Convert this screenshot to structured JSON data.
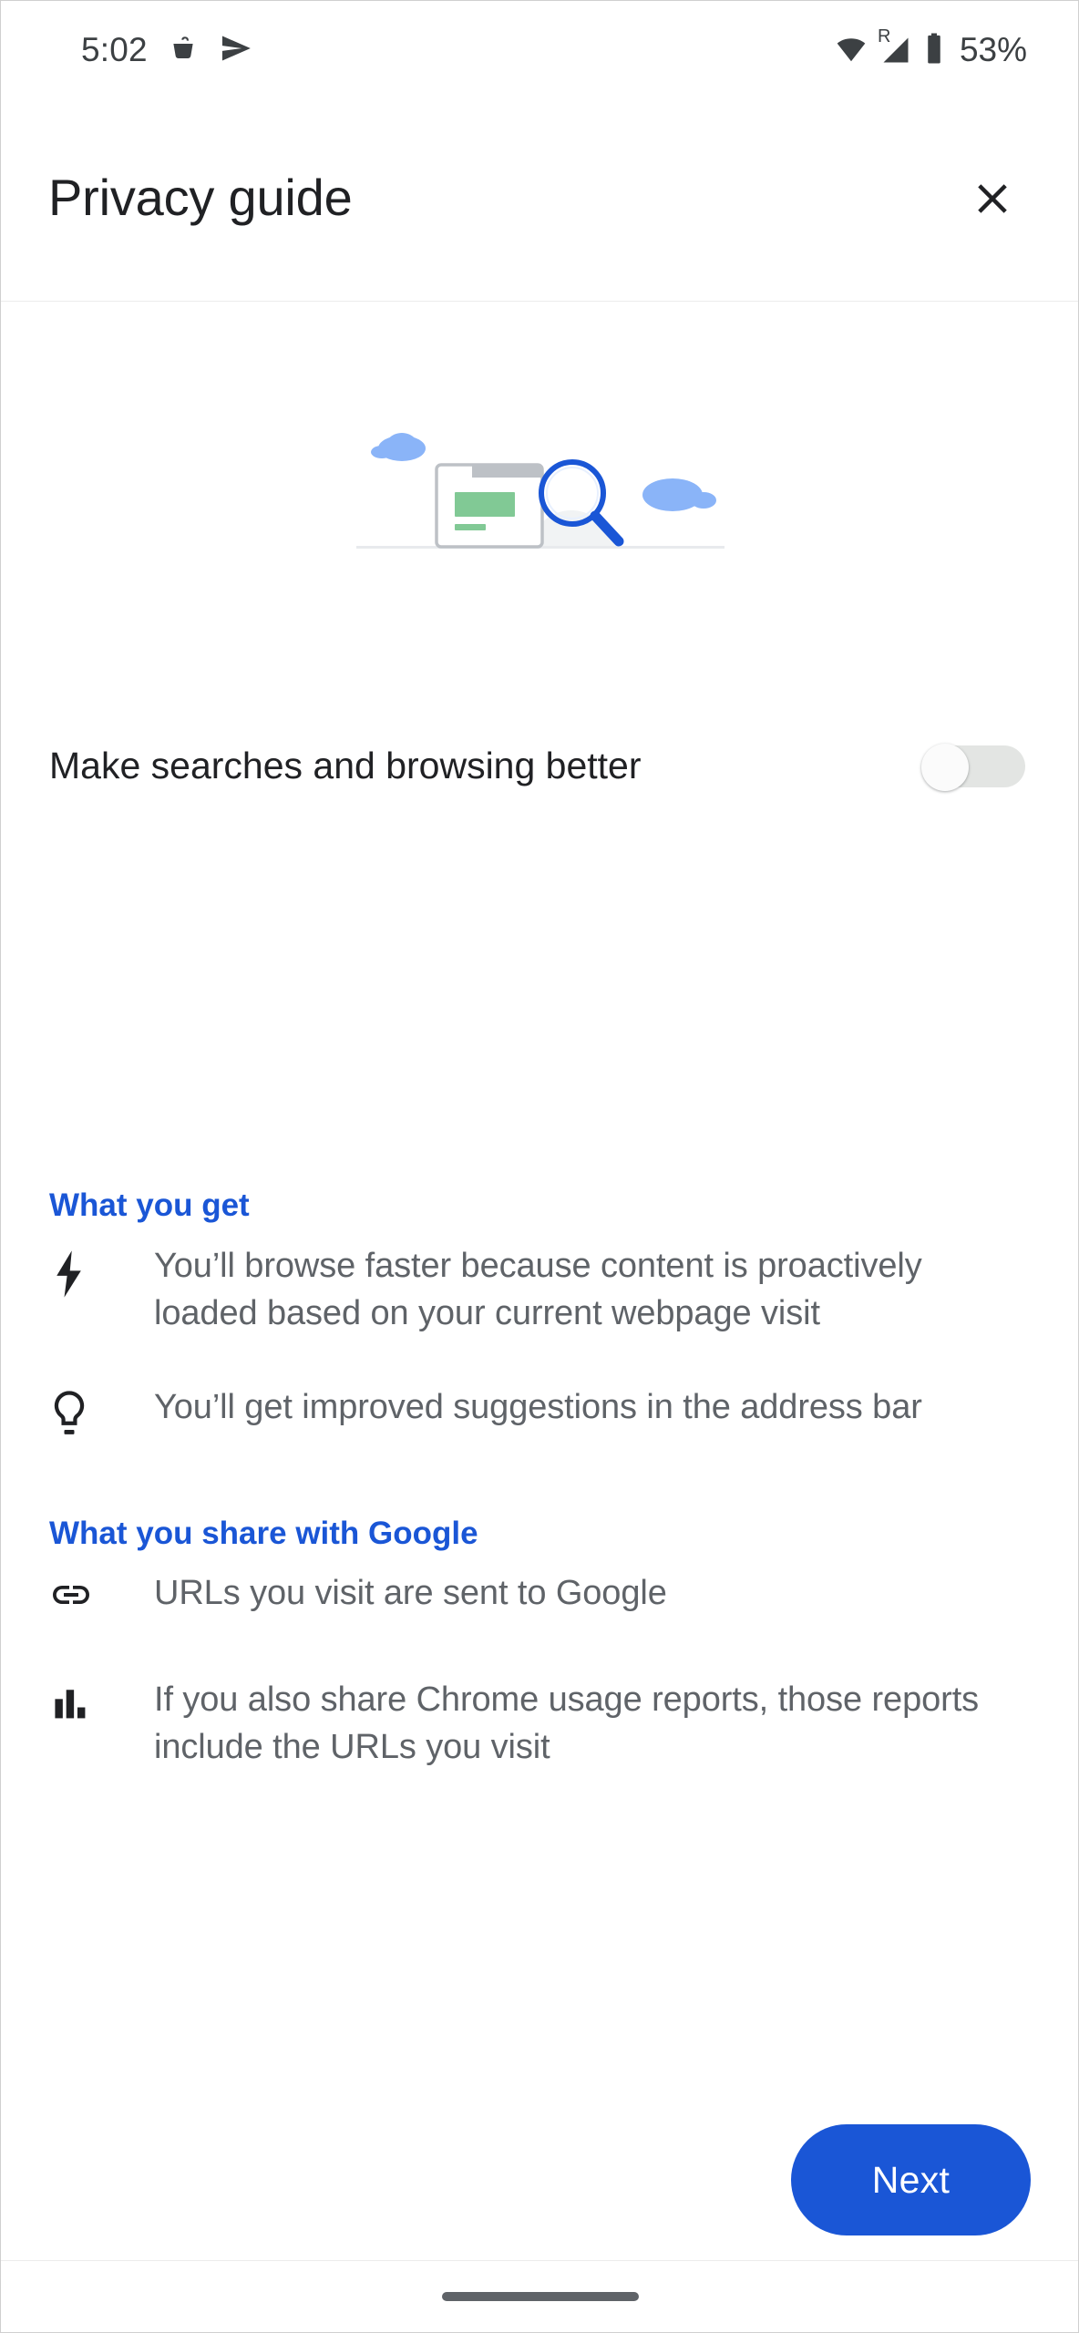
{
  "status_bar": {
    "time": "5:02",
    "battery_percent": "53%",
    "roaming_label": "R",
    "icons": [
      "drink-icon",
      "send-icon",
      "wifi-icon",
      "cellular-signal-icon",
      "battery-icon"
    ]
  },
  "app_bar": {
    "title": "Privacy guide",
    "close_icon": "close-icon"
  },
  "illustration": {
    "name": "search-and-browsing-illustration",
    "cloud_color": "#8ab4f8",
    "card_border_color": "#bdc1c6",
    "card_tab_color": "#bdc1c6",
    "highlight_color": "#81c995",
    "magnifier_color": "#1a56d6"
  },
  "toggle": {
    "label": "Make searches and browsing better",
    "state": "off",
    "track_color": "#e3e5e3",
    "thumb_color": "#fbfbfb"
  },
  "sections": [
    {
      "header": "What you get",
      "header_color": "#1a56d6",
      "items": [
        {
          "icon": "bolt-icon",
          "text": "You’ll browse faster because content is proactively loaded based on your current webpage visit"
        },
        {
          "icon": "lightbulb-icon",
          "text": "You’ll get improved suggestions in the address bar"
        }
      ]
    },
    {
      "header": "What you share with Google",
      "header_color": "#1a56d6",
      "items": [
        {
          "icon": "link-icon",
          "text": "URLs you visit are sent to Google"
        },
        {
          "icon": "bar-chart-icon",
          "text": "If you also share Chrome usage reports, those reports include the URLs you visit"
        }
      ]
    }
  ],
  "footer": {
    "next_label": "Next",
    "next_color": "#1a56d6"
  },
  "nav_bar": {
    "gesture_handle": "gesture-handle"
  }
}
